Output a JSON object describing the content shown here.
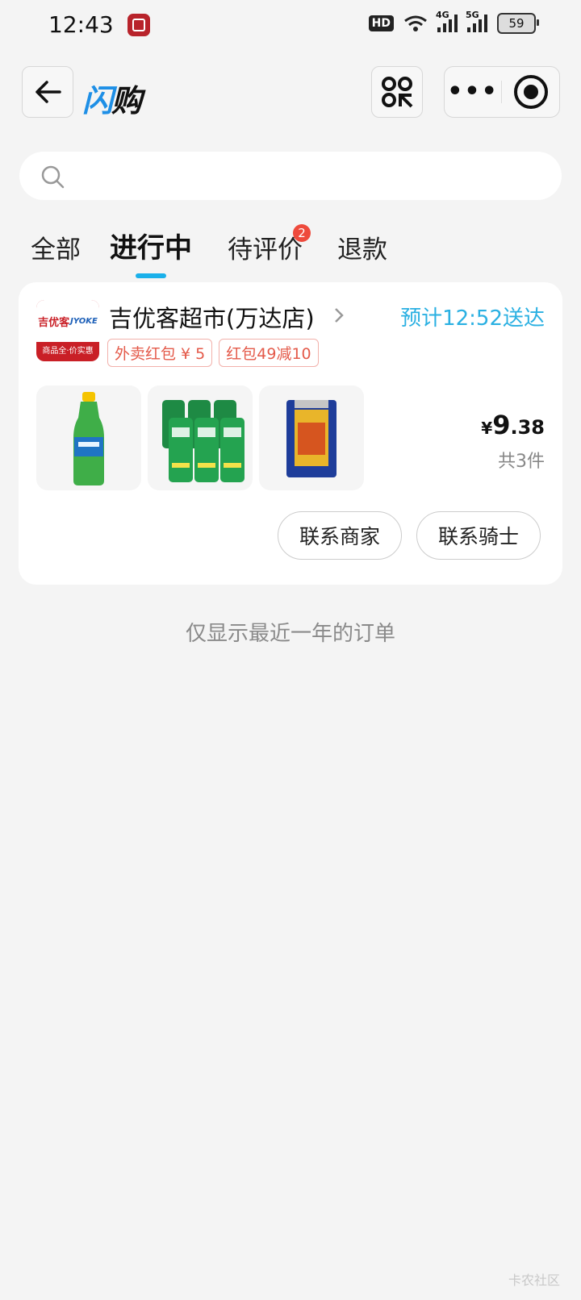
{
  "status_bar": {
    "time": "12:43",
    "hd_label": "HD",
    "net_4g": "4G",
    "net_5g": "5G",
    "battery": "59"
  },
  "header": {
    "brand_part1": "闪",
    "brand_part2": "购"
  },
  "search": {
    "placeholder": ""
  },
  "tabs": [
    {
      "label": "全部"
    },
    {
      "label": "进行中",
      "active": true
    },
    {
      "label": "待评价",
      "badge": "2"
    },
    {
      "label": "退款"
    }
  ],
  "order": {
    "logo_cn": "吉优客",
    "logo_en": "JYOKE",
    "logo_slogan": "商品全·价实惠",
    "store_name": "吉优客超市(万达店)",
    "eta": "预计12:52送达",
    "tags": [
      "外卖红包 ¥ 5",
      "红包49减10"
    ],
    "products": [
      {
        "name": "sprite-bottle"
      },
      {
        "name": "beer-six-pack"
      },
      {
        "name": "snack-pack"
      }
    ],
    "price_symbol": "¥",
    "price_int": "9",
    "price_dec": ".38",
    "count": "共3件",
    "contact_merchant": "联系商家",
    "contact_rider": "联系骑士"
  },
  "footer_note": "仅显示最近一年的订单",
  "watermark": "卡农社区",
  "colors": {
    "accent": "#1ab0ea",
    "badge": "#ee4a3c",
    "tag_text": "#e45a4a",
    "brand_red": "#c91f26"
  }
}
